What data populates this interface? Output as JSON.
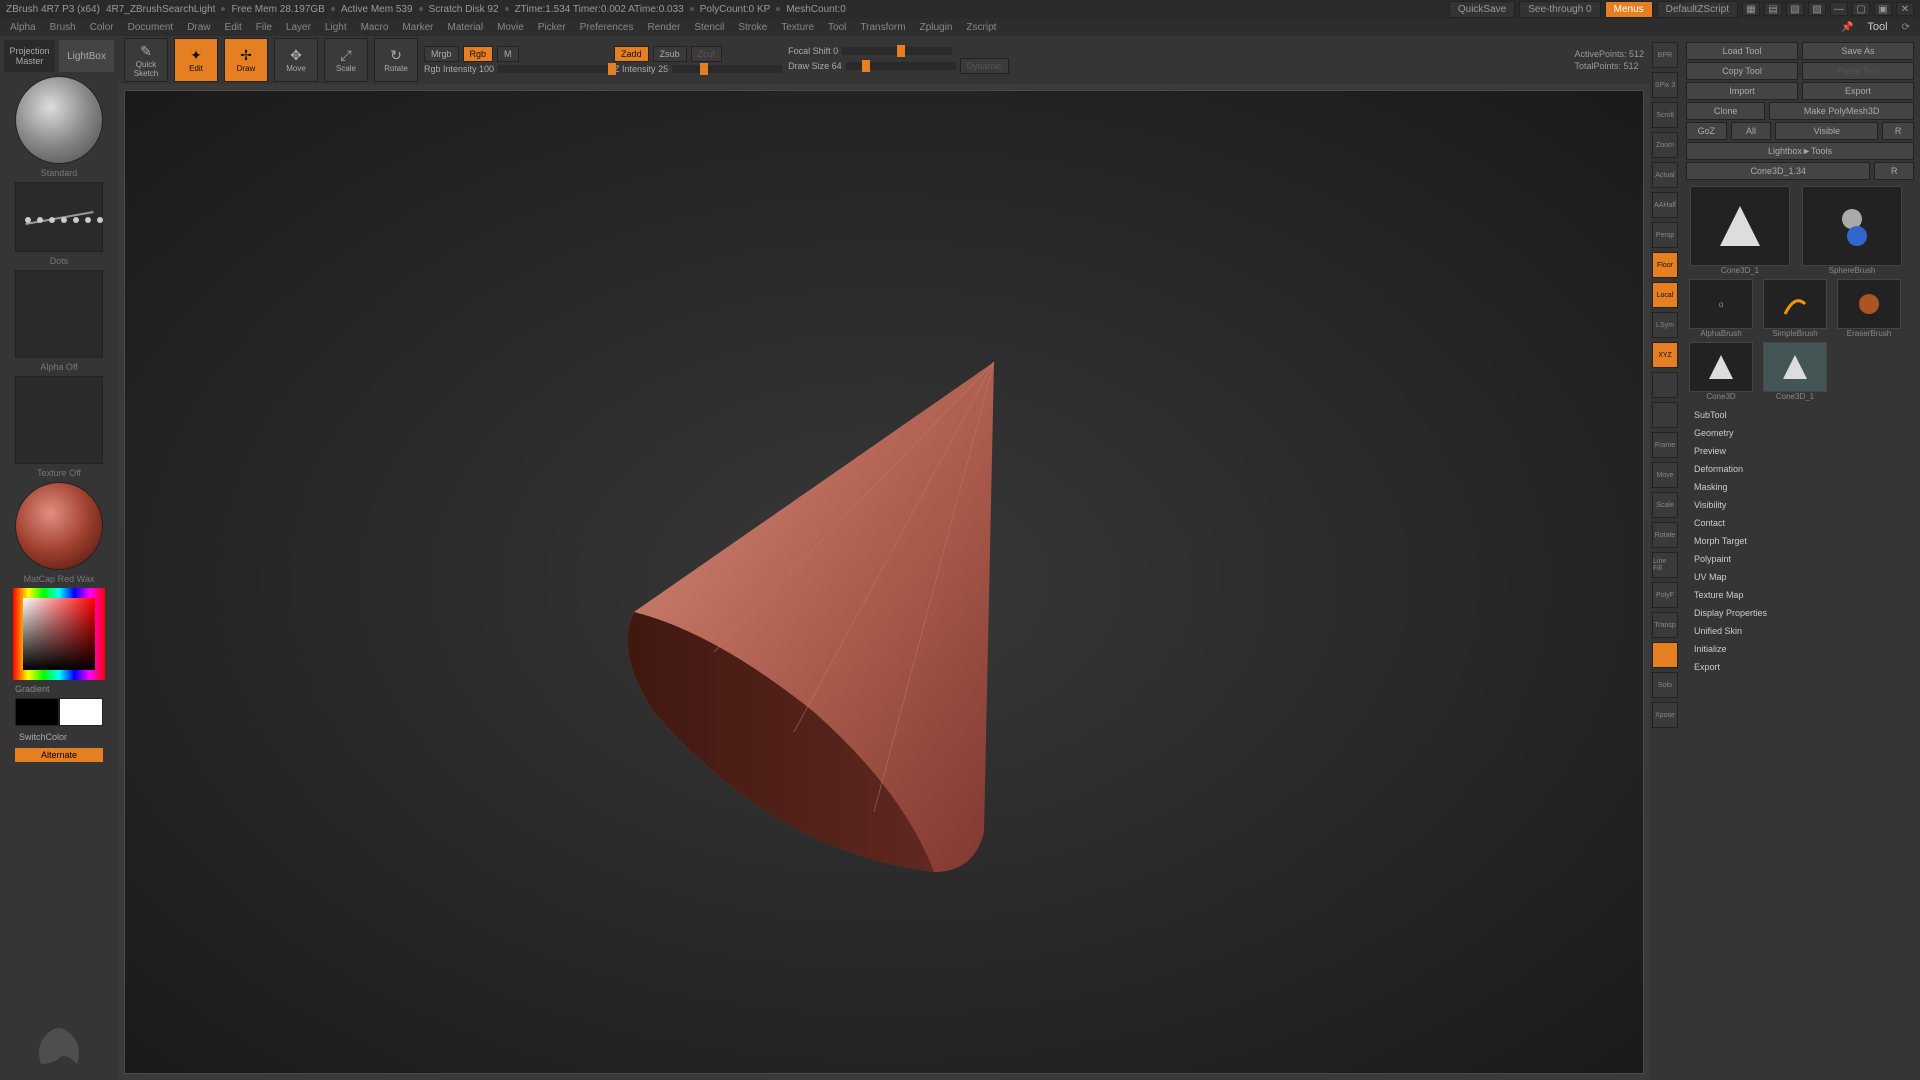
{
  "topbar": {
    "app": "ZBrush 4R7 P3 (x64)",
    "doc": "4R7_ZBrushSearchLight",
    "free_mem": "Free Mem 28.197GB",
    "active_mem": "Active Mem 539",
    "scratch": "Scratch Disk 92",
    "ztime": "ZTime:1.534 Timer:0.002 ATime:0.033",
    "polycount": "PolyCount:0 KP",
    "meshcount": "MeshCount:0",
    "quicksave": "QuickSave",
    "seethrough": "See-through   0",
    "menus": "Menus",
    "script": "DefaultZScript"
  },
  "menubar": [
    "Alpha",
    "Brush",
    "Color",
    "Document",
    "Draw",
    "Edit",
    "File",
    "Layer",
    "Light",
    "Macro",
    "Marker",
    "Material",
    "Movie",
    "Picker",
    "Preferences",
    "Render",
    "Stencil",
    "Stroke",
    "Texture",
    "Tool",
    "Transform",
    "Zplugin",
    "Zscript"
  ],
  "menubar_title": "Tool",
  "left": {
    "projection": "Projection\nMaster",
    "lightbox": "LightBox",
    "brush_label": "Standard",
    "stroke_label": "Dots",
    "alpha_label": "Alpha  Off",
    "texture_label": "Texture Off",
    "material_label": "MatCap Red Wax",
    "gradient": "Gradient",
    "switch": "SwitchColor",
    "alternate": "Alternate"
  },
  "toolbar": {
    "quick_sketch": "Quick\nSketch",
    "edit": "Edit",
    "draw": "Draw",
    "move": "Move",
    "scale": "Scale",
    "rotate": "Rotate",
    "mrgb": "Mrgb",
    "rgb": "Rgb",
    "m": "M",
    "rgb_intensity": "Rgb Intensity 100",
    "zadd": "Zadd",
    "zsub": "Zsub",
    "zcut": "Zcut",
    "z_intensity": "Z Intensity 25",
    "focal_shift": "Focal Shift 0",
    "draw_size": "Draw Size 64",
    "dynamic": "Dynamic",
    "active_points": "ActivePoints: 512",
    "total_points": "TotalPoints: 512"
  },
  "right_icons": [
    "BPR",
    "SPix 3",
    "Scroll",
    "Zoom",
    "Actual",
    "AAHalf",
    "Persp",
    "Floor",
    "Local",
    "LSym",
    "XYZ",
    "",
    "",
    "Frame",
    "Move",
    "Scale",
    "Rotate",
    "Line Fill",
    "PolyF",
    "Transp",
    "",
    "Solo",
    "Xpose"
  ],
  "right_panel": {
    "title": "Tool",
    "load": "Load Tool",
    "save": "Save As",
    "copy": "Copy Tool",
    "paste": "Paste Tool",
    "import": "Import",
    "export_btn": "Export",
    "clone": "Clone",
    "polymesh": "Make PolyMesh3D",
    "goz": "GoZ",
    "all": "All",
    "visible": "Visible",
    "r": "R",
    "lightbox_tools": "Lightbox►Tools",
    "current_tool": "Cone3D_1.34",
    "tools": [
      "Cone3D_1",
      "SphereBrush",
      "AlphaBrush",
      "SimpleBrush",
      "EraserBrush",
      "Cone3D",
      "Cone3D_1"
    ],
    "sections": [
      "SubTool",
      "Geometry",
      "Preview",
      "Deformation",
      "Masking",
      "Visibility",
      "Contact",
      "Morph Target",
      "Polypaint",
      "UV Map",
      "Texture Map",
      "Display Properties",
      "Unified Skin",
      "Initialize",
      "Export"
    ]
  }
}
